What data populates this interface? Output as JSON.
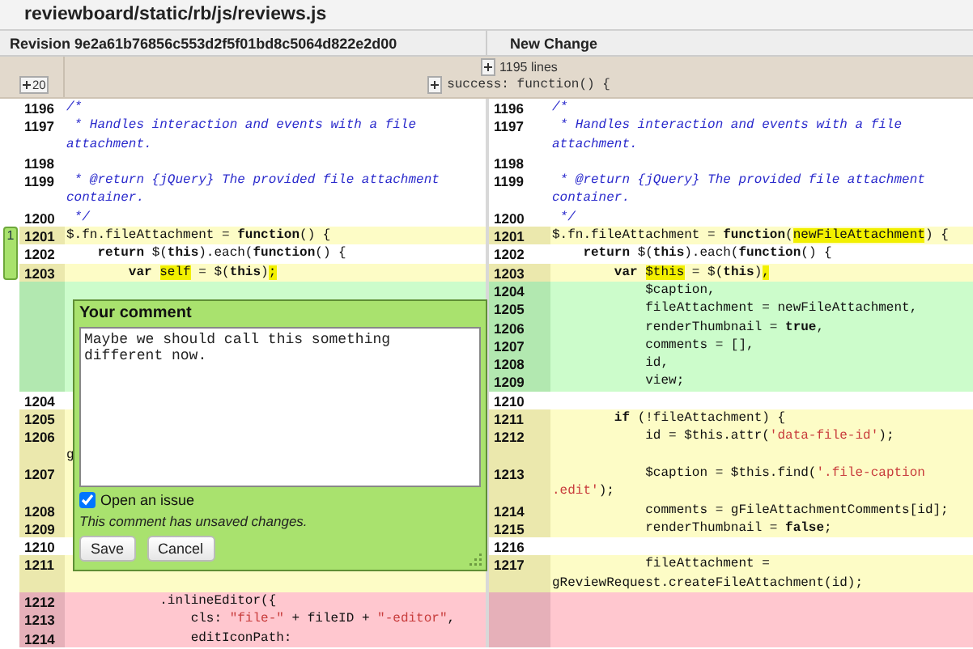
{
  "file_title": "reviewboard/static/rb/js/reviews.js",
  "headers": {
    "left": "Revision 9e2a61b76856c553d2f5f01bd8c5064d822e2d00",
    "right": "New Change"
  },
  "collapsed": {
    "expand_count": "20",
    "hidden_lines": "1195 lines",
    "context": "success: function() {"
  },
  "rows": [
    {
      "kind": "equal",
      "left_num": "1196",
      "right_num": "1196",
      "left": [
        {
          "t": "/*",
          "kind": "cmt"
        }
      ],
      "right": [
        {
          "t": "/*",
          "kind": "cmt"
        }
      ]
    },
    {
      "kind": "equal",
      "left_num": "1197",
      "right_num": "1197",
      "left": [
        {
          "t": " * Handles interaction and events with a file\nattachment.",
          "kind": "cmt"
        }
      ],
      "right": [
        {
          "t": " * Handles interaction and events with a file\nattachment.",
          "kind": "cmt"
        }
      ]
    },
    {
      "kind": "equal",
      "left_num": "1198",
      "right_num": "1198",
      "left": [],
      "right": []
    },
    {
      "kind": "equal",
      "left_num": "1199",
      "right_num": "1199",
      "left": [
        {
          "t": " * @return {jQuery} The provided file attachment\ncontainer.",
          "kind": "cmt"
        }
      ],
      "right": [
        {
          "t": " * @return {jQuery} The provided file attachment\ncontainer.",
          "kind": "cmt"
        }
      ]
    },
    {
      "kind": "equal",
      "left_num": "1200",
      "right_num": "1200",
      "left": [
        {
          "t": " */",
          "kind": "cmt"
        }
      ],
      "right": [
        {
          "t": " */",
          "kind": "cmt"
        }
      ]
    },
    {
      "kind": "replace",
      "comment_count": "1",
      "left_num": "1201",
      "right_num": "1201",
      "left": [
        {
          "t": "$.fn.fileAttachment = ",
          "kind": "plain"
        },
        {
          "t": "function",
          "kind": "kw"
        },
        {
          "t": "() {",
          "kind": "plain"
        }
      ],
      "right": [
        {
          "t": "$.fn.fileAttachment = ",
          "kind": "plain"
        },
        {
          "t": "function",
          "kind": "kw"
        },
        {
          "t": "(",
          "kind": "plain"
        },
        {
          "t": "newFileAttachment",
          "kind": "hl"
        },
        {
          "t": ") {",
          "kind": "plain"
        }
      ]
    },
    {
      "kind": "equal",
      "left_num": "1202",
      "right_num": "1202",
      "left": [
        {
          "t": "    return",
          "kind": "kw"
        },
        {
          "t": " $(",
          "kind": "plain"
        },
        {
          "t": "this",
          "kind": "kw"
        },
        {
          "t": ").each(",
          "kind": "plain"
        },
        {
          "t": "function",
          "kind": "kw"
        },
        {
          "t": "() {",
          "kind": "plain"
        }
      ],
      "right": [
        {
          "t": "    return",
          "kind": "kw"
        },
        {
          "t": " $(",
          "kind": "plain"
        },
        {
          "t": "this",
          "kind": "kw"
        },
        {
          "t": ").each(",
          "kind": "plain"
        },
        {
          "t": "function",
          "kind": "kw"
        },
        {
          "t": "() {",
          "kind": "plain"
        }
      ]
    },
    {
      "kind": "replace",
      "left_num": "1203",
      "right_num": "1203",
      "left": [
        {
          "t": "        var ",
          "kind": "kw"
        },
        {
          "t": "self",
          "kind": "hl"
        },
        {
          "t": " = $(",
          "kind": "plain"
        },
        {
          "t": "this",
          "kind": "kw"
        },
        {
          "t": ")",
          "kind": "plain"
        },
        {
          "t": ";",
          "kind": "hl"
        }
      ],
      "right": [
        {
          "t": "        var ",
          "kind": "kw"
        },
        {
          "t": "$this",
          "kind": "hl"
        },
        {
          "t": " = $(",
          "kind": "plain"
        },
        {
          "t": "this",
          "kind": "kw"
        },
        {
          "t": ")",
          "kind": "plain"
        },
        {
          "t": ",",
          "kind": "hl"
        }
      ]
    },
    {
      "kind": "insert",
      "right_num": "1204",
      "left": [],
      "right": [
        {
          "t": "            $caption,",
          "kind": "plain"
        }
      ]
    },
    {
      "kind": "insert",
      "right_num": "1205",
      "left": [],
      "right": [
        {
          "t": "            fileAttachment = newFileAttachment,",
          "kind": "plain"
        }
      ]
    },
    {
      "kind": "insert",
      "right_num": "1206",
      "left": [],
      "right": [
        {
          "t": "            renderThumbnail = ",
          "kind": "plain"
        },
        {
          "t": "true",
          "kind": "kw"
        },
        {
          "t": ",",
          "kind": "plain"
        }
      ]
    },
    {
      "kind": "insert",
      "right_num": "1207",
      "left": [],
      "right": [
        {
          "t": "            comments = [],",
          "kind": "plain"
        }
      ]
    },
    {
      "kind": "insert",
      "right_num": "1208",
      "left": [],
      "right": [
        {
          "t": "            id,",
          "kind": "plain"
        }
      ]
    },
    {
      "kind": "insert",
      "right_num": "1209",
      "left": [],
      "right": [
        {
          "t": "            view;",
          "kind": "plain"
        }
      ]
    },
    {
      "kind": "equal",
      "left_num": "1204",
      "right_num": "1210",
      "left": [],
      "right": []
    },
    {
      "kind": "replace",
      "left_num": "1205",
      "right_num": "1211",
      "left": [],
      "right": [
        {
          "t": "        if",
          "kind": "kw"
        },
        {
          "t": " (!fileAttachment) {",
          "kind": "plain"
        }
      ]
    },
    {
      "kind": "replace",
      "left_num": "1206",
      "right_num": "1212",
      "left": [
        {
          "t": "\ng",
          "kind": "plain"
        }
      ],
      "right": [
        {
          "t": "            id = $this.attr(",
          "kind": "plain"
        },
        {
          "t": "'data-file-id'",
          "kind": "str"
        },
        {
          "t": ");",
          "kind": "plain"
        }
      ]
    },
    {
      "kind": "replace",
      "left_num": "1207",
      "right_num": "1213",
      "left": [],
      "right": [
        {
          "t": "            $caption = $this.find(",
          "kind": "plain"
        },
        {
          "t": "'.file-caption\n.edit'",
          "kind": "str"
        },
        {
          "t": ");",
          "kind": "plain"
        }
      ]
    },
    {
      "kind": "replace",
      "left_num": "1208",
      "right_num": "1214",
      "left": [],
      "right": [
        {
          "t": "            comments = gFileAttachmentComments[id];",
          "kind": "plain"
        }
      ]
    },
    {
      "kind": "replace",
      "left_num": "1209",
      "right_num": "1215",
      "left": [],
      "right": [
        {
          "t": "            renderThumbnail = ",
          "kind": "plain"
        },
        {
          "t": "false",
          "kind": "kw"
        },
        {
          "t": ";",
          "kind": "plain"
        }
      ]
    },
    {
      "kind": "equal",
      "left_num": "1210",
      "right_num": "1216",
      "left": [],
      "right": []
    },
    {
      "kind": "replace",
      "left_num": "1211",
      "right_num": "1217",
      "left": [],
      "right": [
        {
          "t": "            fileAttachment =\ngReviewRequest.createFileAttachment(id);",
          "kind": "plain"
        }
      ]
    },
    {
      "kind": "delete",
      "left_num": "1212",
      "left": [
        {
          "t": "            .inlineEditor({",
          "kind": "plain"
        }
      ],
      "right": []
    },
    {
      "kind": "delete",
      "left_num": "1213",
      "left": [
        {
          "t": "                cls: ",
          "kind": "plain"
        },
        {
          "t": "\"file-\"",
          "kind": "str"
        },
        {
          "t": " + fileID + ",
          "kind": "plain"
        },
        {
          "t": "\"-editor\"",
          "kind": "str"
        },
        {
          "t": ",",
          "kind": "plain"
        }
      ],
      "right": []
    },
    {
      "kind": "delete",
      "left_num": "1214",
      "left": [
        {
          "t": "                editIconPath:",
          "kind": "plain"
        }
      ],
      "right": []
    }
  ],
  "comment_dialog": {
    "title": "Your comment",
    "text": "Maybe we should call this something\ndifferent now.",
    "open_issue": {
      "label": "Open an issue",
      "checked": true
    },
    "status": "This comment has unsaved changes.",
    "buttons": [
      "Save",
      "Cancel"
    ]
  }
}
